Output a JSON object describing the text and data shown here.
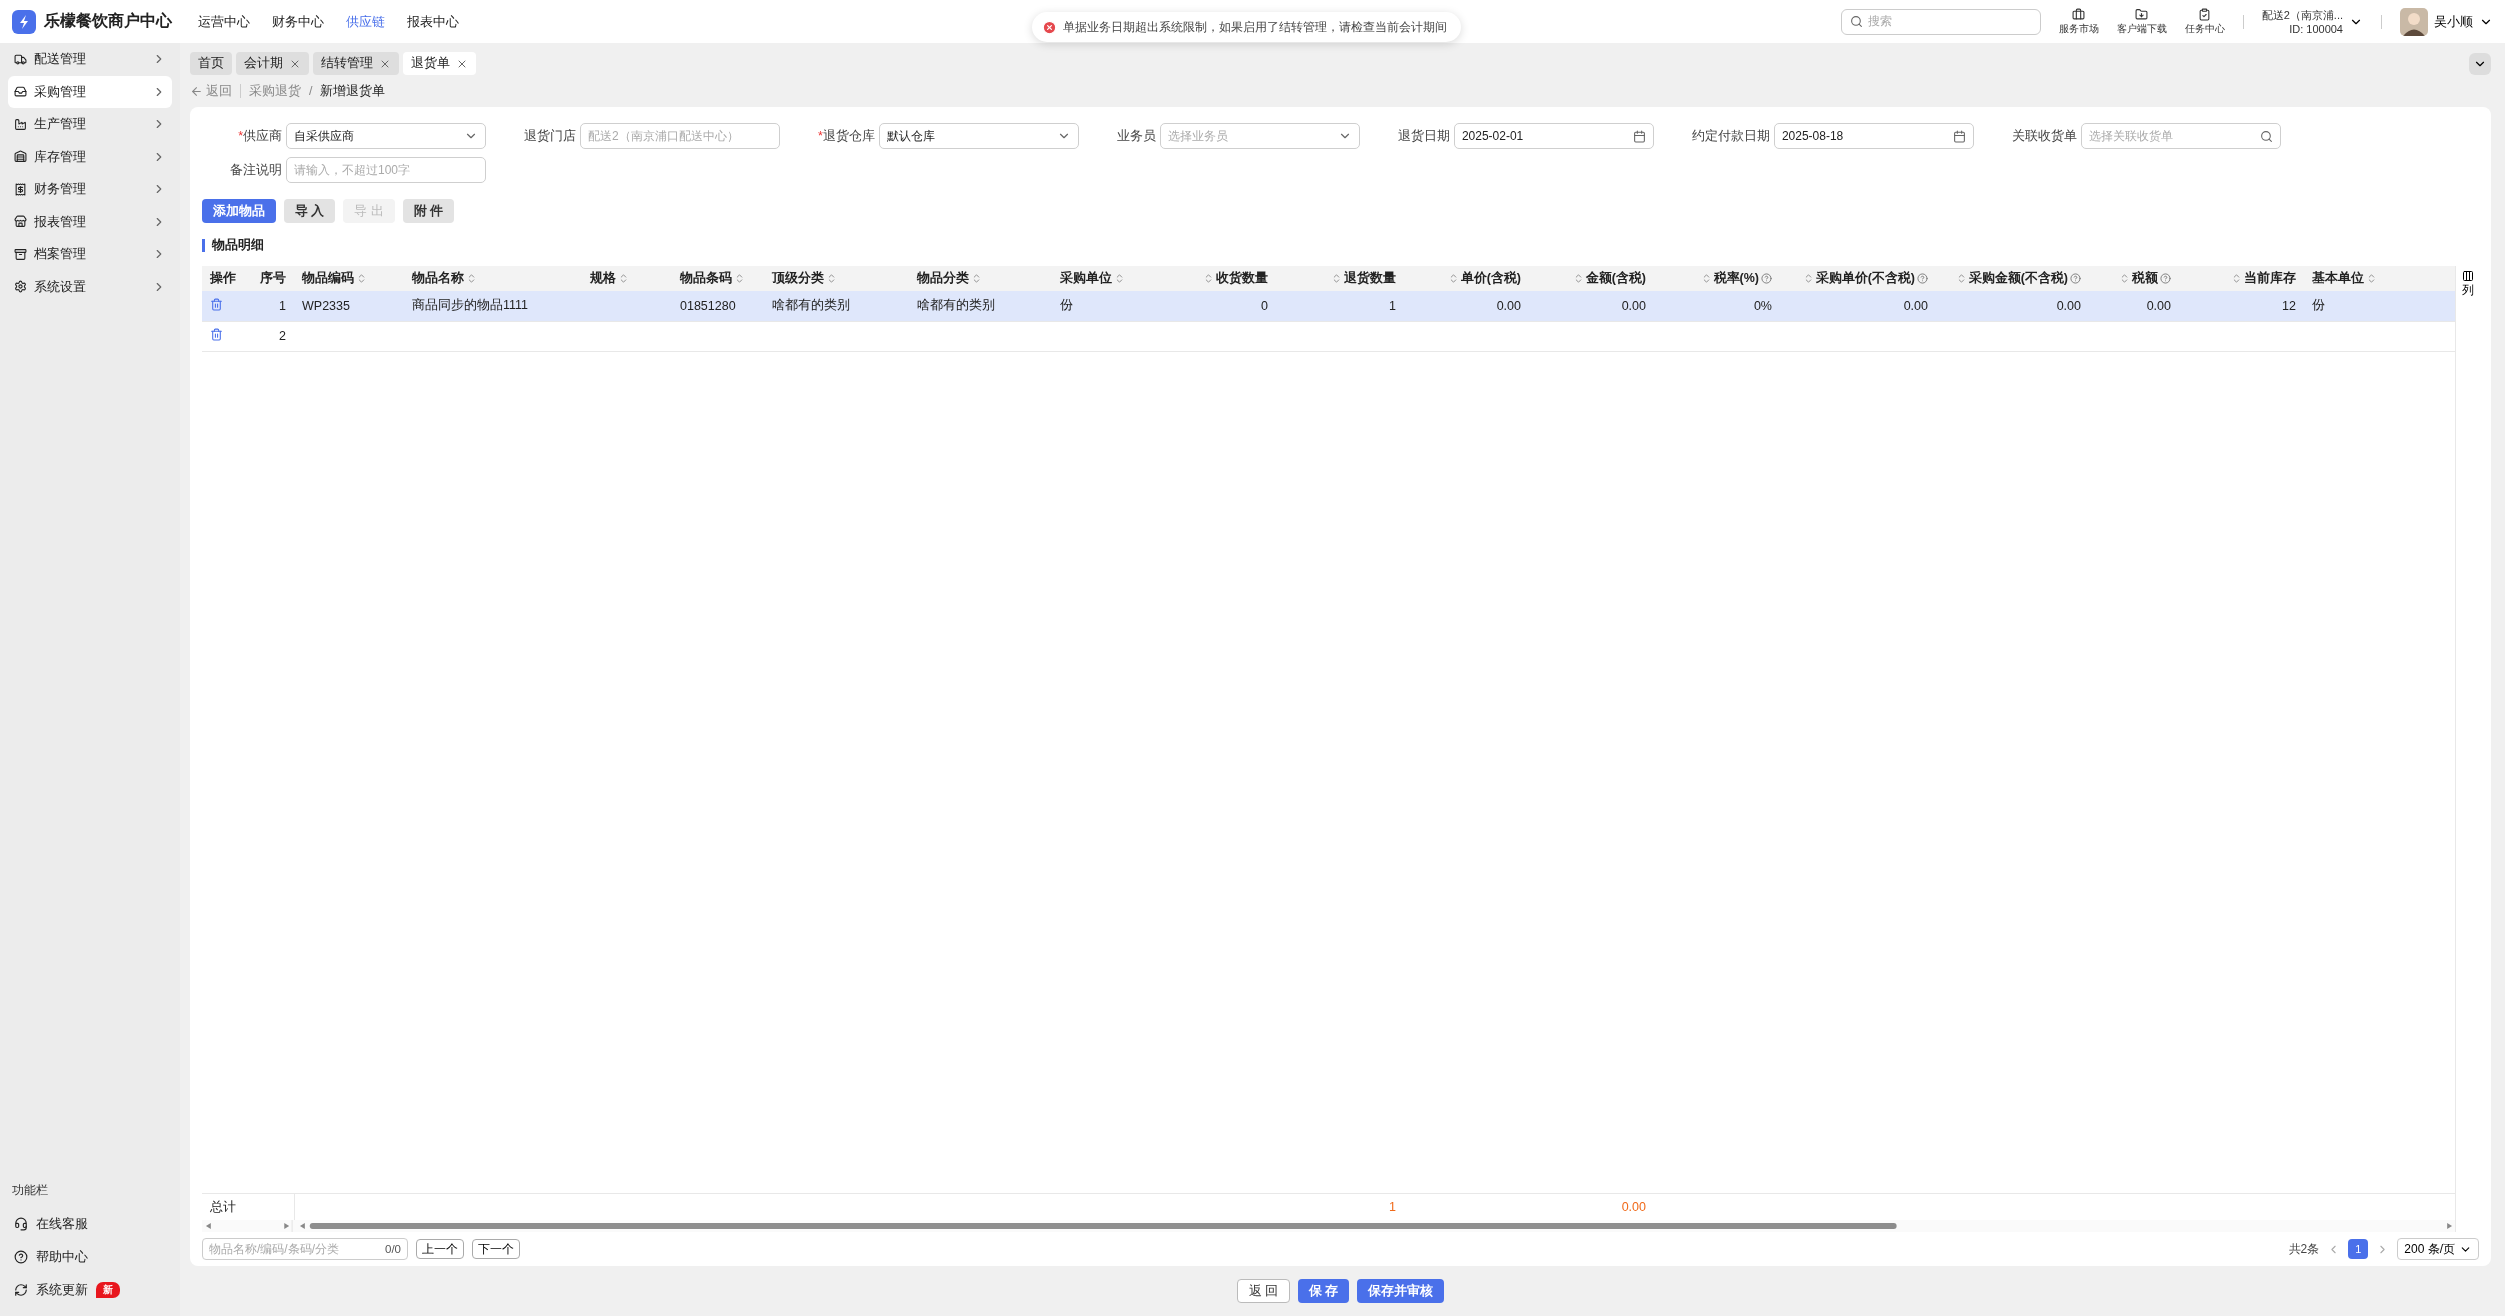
{
  "header": {
    "logo_text": "乐檬餐饮商户中心",
    "nav": [
      {
        "label": "运营中心",
        "selected": false
      },
      {
        "label": "财务中心",
        "selected": false
      },
      {
        "label": "供应链",
        "selected": true
      },
      {
        "label": "报表中心",
        "selected": false
      }
    ],
    "toast": "单据业务日期超出系统限制，如果启用了结转管理，请检查当前会计期间",
    "search": {
      "placeholder": "搜索"
    },
    "tools": [
      "服务市场",
      "客户端下载",
      "任务中心"
    ],
    "store": {
      "name": "配送2（南京浦...",
      "id": "ID: 100004"
    },
    "user": "吴小顺"
  },
  "sidebar": {
    "items": [
      {
        "label": "配送管理",
        "selected": false
      },
      {
        "label": "采购管理",
        "selected": true
      },
      {
        "label": "生产管理",
        "selected": false
      },
      {
        "label": "库存管理",
        "selected": false
      },
      {
        "label": "财务管理",
        "selected": false
      },
      {
        "label": "报表管理",
        "selected": false
      },
      {
        "label": "档案管理",
        "selected": false
      },
      {
        "label": "系统设置",
        "selected": false
      }
    ],
    "footer_title": "功能栏",
    "footer_items": [
      {
        "label": "在线客服"
      },
      {
        "label": "帮助中心"
      },
      {
        "label": "系统更新",
        "badge": "新"
      }
    ]
  },
  "tabs": [
    {
      "label": "首页",
      "selected": false,
      "closable": false
    },
    {
      "label": "会计期",
      "selected": false,
      "closable": true
    },
    {
      "label": "结转管理",
      "selected": false,
      "closable": true
    },
    {
      "label": "退货单",
      "selected": true,
      "closable": true
    }
  ],
  "breadcrumb": {
    "back": "返回",
    "separator": "/",
    "items": [
      "采购退货",
      "新增退货单"
    ]
  },
  "required_mark": "*",
  "form": [
    {
      "label": "供应商",
      "required": true,
      "kind": "select",
      "value": "自采供应商"
    },
    {
      "label": "退货门店",
      "required": false,
      "kind": "disabled",
      "value": "配送2（南京浦口配送中心）"
    },
    {
      "label": "退货仓库",
      "required": true,
      "kind": "select",
      "value": "默认仓库"
    },
    {
      "label": "业务员",
      "required": false,
      "kind": "select",
      "placeholder": "选择业务员"
    },
    {
      "label": "退货日期",
      "required": false,
      "kind": "date",
      "value": "2025-02-01"
    },
    {
      "label": "约定付款日期",
      "required": false,
      "kind": "date",
      "value": "2025-08-18"
    },
    {
      "label": "关联收货单",
      "required": false,
      "kind": "search",
      "placeholder": "选择关联收货单"
    },
    {
      "label": "备注说明",
      "required": false,
      "kind": "text",
      "placeholder": "请输入，不超过100字"
    }
  ],
  "actions": [
    {
      "label": "添加物品",
      "primary": true,
      "disabled": false
    },
    {
      "label": "导 入",
      "primary": false,
      "disabled": false
    },
    {
      "label": "导 出",
      "primary": false,
      "disabled": true
    },
    {
      "label": "附 件",
      "primary": false,
      "disabled": false
    }
  ],
  "section_title": "物品明细",
  "table": {
    "columns": [
      {
        "label": "操作",
        "sortable": false,
        "numeric": false,
        "help": false
      },
      {
        "label": "序号",
        "sortable": false,
        "numeric": true,
        "help": false
      },
      {
        "label": "物品编码",
        "sortable": true,
        "numeric": false,
        "help": false
      },
      {
        "label": "物品名称",
        "sortable": true,
        "numeric": false,
        "help": false
      },
      {
        "label": "规格",
        "sortable": true,
        "numeric": false,
        "help": false
      },
      {
        "label": "物品条码",
        "sortable": true,
        "numeric": false,
        "help": false
      },
      {
        "label": "顶级分类",
        "sortable": true,
        "numeric": false,
        "help": false
      },
      {
        "label": "物品分类",
        "sortable": true,
        "numeric": false,
        "help": false
      },
      {
        "label": "采购单位",
        "sortable": true,
        "numeric": false,
        "help": false
      },
      {
        "label": "收货数量",
        "sortable": true,
        "numeric": true,
        "help": false
      },
      {
        "label": "退货数量",
        "sortable": true,
        "numeric": true,
        "help": false
      },
      {
        "label": "单价(含税)",
        "sortable": true,
        "numeric": true,
        "help": false
      },
      {
        "label": "金额(含税)",
        "sortable": true,
        "numeric": true,
        "help": false
      },
      {
        "label": "税率(%)",
        "sortable": true,
        "numeric": true,
        "help": true
      },
      {
        "label": "采购单价(不含税)",
        "sortable": true,
        "numeric": true,
        "help": true
      },
      {
        "label": "采购金额(不含税)",
        "sortable": true,
        "numeric": true,
        "help": true
      },
      {
        "label": "税额",
        "sortable": true,
        "numeric": true,
        "help": true
      },
      {
        "label": "当前库存",
        "sortable": true,
        "numeric": true,
        "help": false
      },
      {
        "label": "基本单位",
        "sortable": true,
        "numeric": false,
        "help": false
      }
    ],
    "rows": [
      {
        "selected": true,
        "cells": [
          null,
          "1",
          "WP2335",
          "商品同步的物品1111",
          null,
          "01851280",
          "啥都有的类别",
          "啥都有的类别",
          "份",
          "0",
          "1",
          "0.00",
          "0.00",
          "0%",
          "0.00",
          "0.00",
          "0.00",
          "12",
          "份"
        ]
      },
      {
        "selected": false,
        "cells": [
          null,
          "2",
          null,
          null,
          null,
          null,
          null,
          null,
          null,
          null,
          null,
          null,
          null,
          null,
          null,
          null,
          null,
          null,
          null
        ]
      }
    ],
    "totals": {
      "cells": [
        "总计",
        null,
        null,
        null,
        null,
        null,
        null,
        null,
        null,
        null,
        "1",
        null,
        "0.00",
        null,
        null,
        null,
        null,
        null,
        null
      ]
    },
    "column_settings": "列"
  },
  "finder": {
    "placeholder": "物品名称/编码/条码/分类",
    "count": "0/0",
    "prev": "上一个",
    "next": "下一个"
  },
  "pagination": {
    "total": "共2条",
    "pages": [
      {
        "label": "1",
        "selected": true
      }
    ],
    "page_size": "200 条/页"
  },
  "footer_buttons": [
    {
      "label": "返 回",
      "primary": false
    },
    {
      "label": "保 存",
      "primary": true
    },
    {
      "label": "保存并审核",
      "primary": true
    }
  ]
}
